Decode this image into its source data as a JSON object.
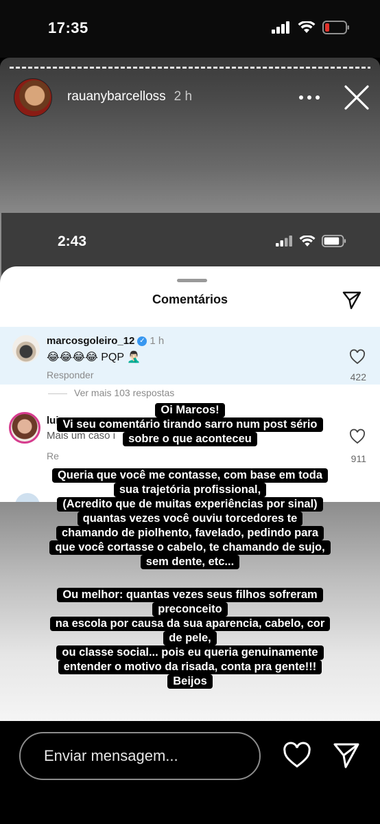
{
  "status_bar": {
    "time": "17:35"
  },
  "story": {
    "username": "rauanybarcelloss",
    "time_ago": "2 h"
  },
  "inner_screenshot": {
    "status_time": "2:43",
    "comments_title": "Comentários",
    "comments": [
      {
        "username": "marcosgoleiro_12",
        "verified": true,
        "time": "1 h",
        "text": "😂😂😂😂 PQP 🤦🏻‍♂️",
        "reply_label": "Responder",
        "likes": "422",
        "more_replies": "Ver mais 103 respostas"
      },
      {
        "username": "luiz",
        "text": "Mais um caso i",
        "reply_label": "Re",
        "likes": "911"
      }
    ]
  },
  "overlay_text": [
    "Oi Marcos!",
    "Vi seu comentário tirando sarro num post sério",
    "sobre o que aconteceu",
    "",
    "Queria que você me contasse, com base em toda",
    "sua trajetória profissional,",
    "(Acredito que de muitas experiências por sinal)",
    "quantas vezes você ouviu torcedores te",
    "chamando de piolhento, favelado, pedindo para",
    "que você cortasse o cabelo, te chamando de sujo,",
    "sem dente, etc...",
    "",
    "Ou melhor: quantas vezes seus filhos sofreram",
    "preconceito",
    "na escola por causa da sua aparencia, cabelo, cor",
    "de pele,",
    "ou classe social... pois eu queria genuinamente",
    "entender o motivo da risada, conta pra gente!!!",
    "Beijos"
  ],
  "bottom_bar": {
    "message_placeholder": "Enviar mensagem..."
  },
  "icons": [
    "signal-icon",
    "wifi-icon",
    "battery-icon",
    "more-icon",
    "close-icon",
    "send-icon",
    "heart-icon"
  ],
  "colors": {
    "battery_low": "#e0322b",
    "highlight_row": "#e7f3fb",
    "verified": "#3897f0"
  }
}
